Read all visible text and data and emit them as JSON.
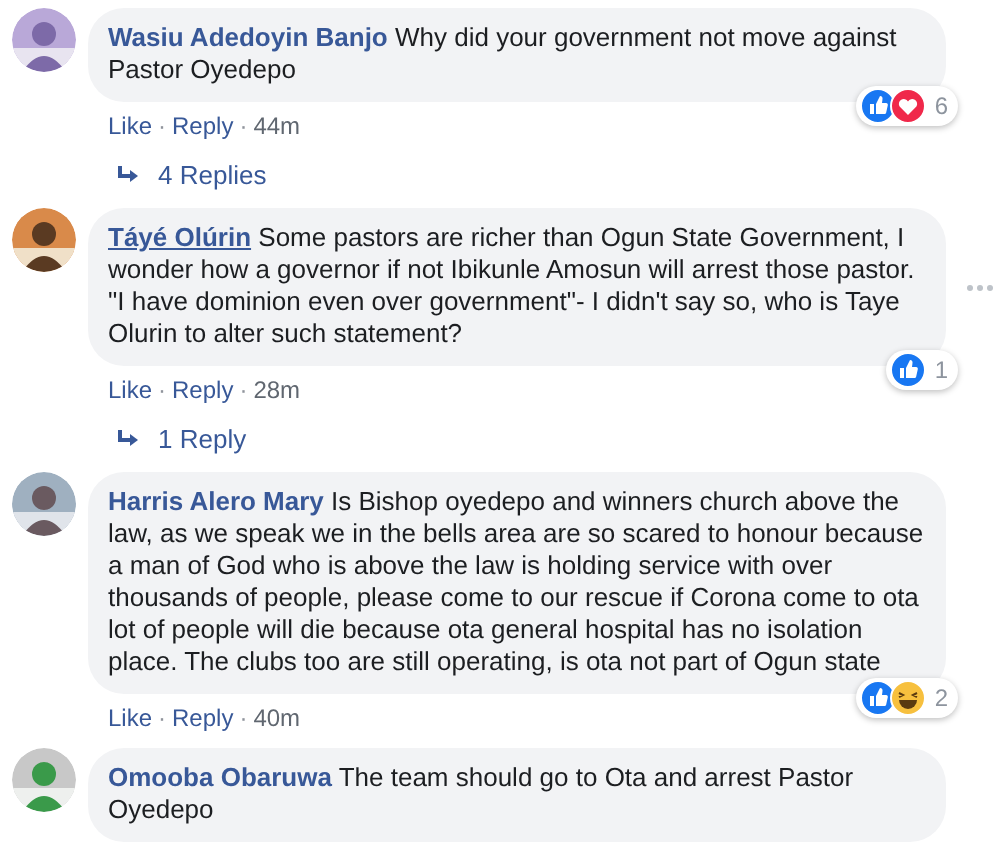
{
  "comments": [
    {
      "author": "Wasiu Adedoyin Banjo",
      "author_underlined": false,
      "avatar": {
        "kind": "picture"
      },
      "text": "Why did your government not move against Pastor Oyedepo",
      "reactions": [
        {
          "kind": "like"
        },
        {
          "kind": "love"
        }
      ],
      "reaction_count": "6",
      "actions": [
        "Like",
        "Reply"
      ],
      "separator": "·",
      "time": "44m",
      "replies": "4 Replies",
      "menu": false
    },
    {
      "author": "Táyé Olúrin",
      "author_underlined": true,
      "avatar": {
        "kind": "picture"
      },
      "text": "Some pastors are richer than Ogun State Government, I wonder how a governor if not Ibikunle Amosun will arrest those pastor. \"I have dominion even over government\"- I didn't say so, who is Taye Olurin to alter such statement?",
      "reactions": [
        {
          "kind": "like"
        }
      ],
      "reaction_count": "1",
      "actions": [
        "Like",
        "Reply"
      ],
      "separator": "·",
      "time": "28m",
      "replies": "1 Reply",
      "menu": true
    },
    {
      "author": "Harris Alero Mary",
      "author_underlined": false,
      "avatar": {
        "kind": "picture"
      },
      "text": "Is Bishop oyedepo and winners church above the law, as we speak we in the bells area are so scared to honour because a man of God who is above the law is holding service with over thousands of people, please come to our rescue if Corona come to ota lot of people will die because ota general hospital has no isolation place. The clubs too are still operating, is ota not part of Ogun state",
      "reactions": [
        {
          "kind": "like"
        },
        {
          "kind": "haha"
        }
      ],
      "reaction_count": "2",
      "actions": [
        "Like",
        "Reply"
      ],
      "separator": "·",
      "time": "40m",
      "menu": false
    },
    {
      "author": "Omooba Obaruwa",
      "author_underlined": false,
      "avatar": {
        "kind": "picture"
      },
      "text": "The team should go to Ota and arrest Pastor Oyedepo",
      "menu": false
    }
  ]
}
